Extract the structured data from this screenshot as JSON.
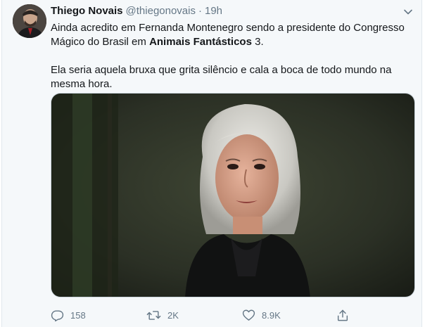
{
  "tweet": {
    "author_name": "Thiego Novais",
    "handle": "@thiegonovais",
    "separator": "·",
    "timestamp": "19h",
    "text_line1_before": "Ainda acredito em Fernanda Montenegro sendo a presidente do Congresso Mágico do Brasil em ",
    "text_bold": "Animais Fantásticos",
    "text_line1_after": " 3.",
    "text_paragraph2": "Ela seria aquela bruxa que grita silêncio e cala a boca de todo mundo na mesma hora.",
    "image_description_icon": "photo",
    "avatar_icon": "user-avatar"
  },
  "actions": {
    "reply_count": "158",
    "retweet_count": "2K",
    "like_count": "8.9K",
    "icons": [
      "reply-icon",
      "retweet-icon",
      "like-icon",
      "share-icon"
    ]
  },
  "colors": {
    "background": "#f5f8fa",
    "text": "#14171a",
    "secondary": "#657786",
    "border": "#ccd6dd"
  }
}
